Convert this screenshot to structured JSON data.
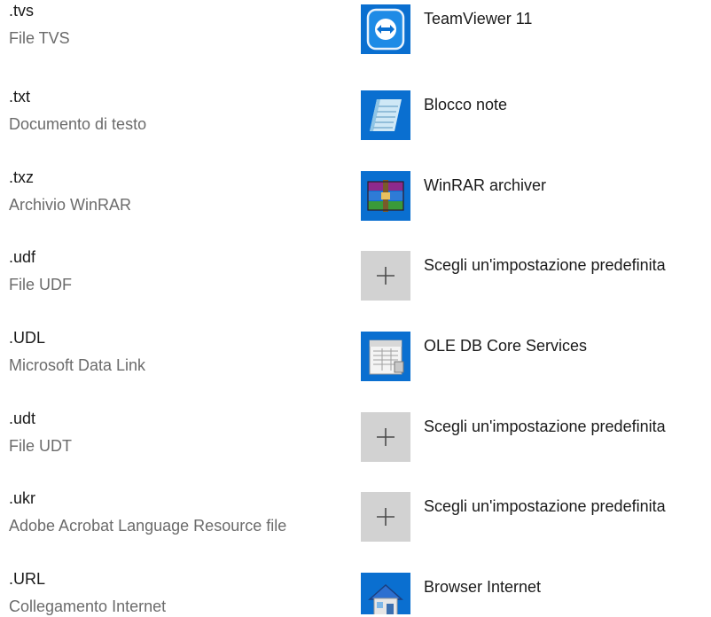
{
  "associations": [
    {
      "extension": ".tvs",
      "description": "File TVS",
      "app": "TeamViewer 11",
      "icon": "teamviewer-icon"
    },
    {
      "extension": ".txt",
      "description": "Documento di testo",
      "app": "Blocco note",
      "icon": "notepad-icon"
    },
    {
      "extension": ".txz",
      "description": "Archivio WinRAR",
      "app": "WinRAR archiver",
      "icon": "winrar-icon"
    },
    {
      "extension": ".udf",
      "description": "File UDF",
      "app": "Scegli un'impostazione predefinita",
      "icon": "plus-icon"
    },
    {
      "extension": ".UDL",
      "description": "Microsoft Data Link",
      "app": "OLE DB Core Services",
      "icon": "ole-db-icon"
    },
    {
      "extension": ".udt",
      "description": "File UDT",
      "app": "Scegli un'impostazione predefinita",
      "icon": "plus-icon"
    },
    {
      "extension": ".ukr",
      "description": "Adobe Acrobat Language Resource file",
      "app": "Scegli un'impostazione predefinita",
      "icon": "plus-icon"
    },
    {
      "extension": ".URL",
      "description": "Collegamento Internet",
      "app": "Browser Internet",
      "icon": "internet-browser-icon"
    }
  ],
  "colors": {
    "tile_blue": "#0a6fd0",
    "tile_empty": "#d2d2d2",
    "primary_text": "#1a1a1a",
    "secondary_text": "#6b6b6b"
  }
}
